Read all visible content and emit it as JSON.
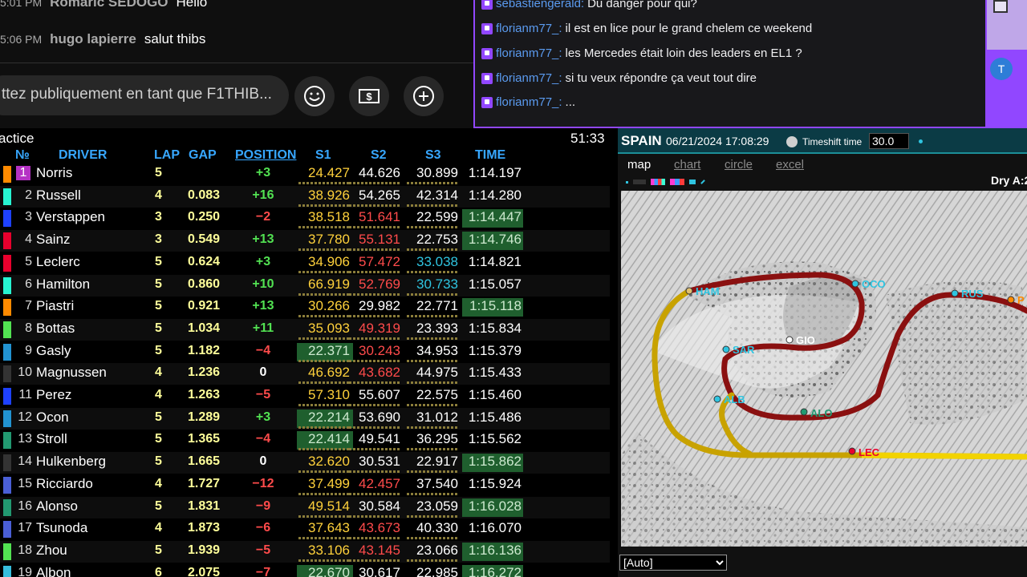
{
  "youtube_chat": {
    "messages": [
      {
        "time": "5:01 PM",
        "author": "Romaric SEDOGO",
        "text": "Hello"
      },
      {
        "time": "5:06 PM",
        "author": "hugo lapierre",
        "text": "salut thibs"
      }
    ],
    "input_placeholder": "ttez publiquement en tant que F1THIB..."
  },
  "twitch_chat": {
    "messages": [
      {
        "author": "sebastiengerald:",
        "text": "Du danger pour qui?"
      },
      {
        "author": "florianm77_:",
        "text": "il est en lice pour le grand chelem ce weekend"
      },
      {
        "author": "florianm77_:",
        "text": "les Mercedes était loin des leaders en EL1 ?"
      },
      {
        "author": "florianm77_:",
        "text": "si tu veux répondre ça veut tout dire"
      },
      {
        "author": "florianm77_:",
        "text": "..."
      }
    ],
    "avatar_letter": "T"
  },
  "timing": {
    "session_label": "actice",
    "clock": "51:33",
    "headers": {
      "no": "№",
      "driver": "DRIVER",
      "lap": "LAP",
      "gap": "GAP",
      "position": "POSITION",
      "s1": "S1",
      "s2": "S2",
      "s3": "S3",
      "time": "TIME"
    },
    "rows": [
      {
        "pos": "1",
        "driver": "Norris",
        "lap": "5",
        "gap": "",
        "change": "+3",
        "s1": "24.427",
        "s2": "44.626",
        "s3": "30.899",
        "time": "1:14.197",
        "team_color": "#ff8a00"
      },
      {
        "pos": "2",
        "driver": "Russell",
        "lap": "4",
        "gap": "0.083",
        "change": "+16",
        "s1": "38.926",
        "s2": "54.265",
        "s3": "42.314",
        "time": "1:14.280",
        "team_color": "#27f4d2"
      },
      {
        "pos": "3",
        "driver": "Verstappen",
        "lap": "3",
        "gap": "0.250",
        "change": "−2",
        "s1": "38.518",
        "s2": "51.641",
        "s3": "22.599",
        "time": "1:14.447",
        "team_color": "#1e41ff"
      },
      {
        "pos": "4",
        "driver": "Sainz",
        "lap": "3",
        "gap": "0.549",
        "change": "+13",
        "s1": "37.780",
        "s2": "55.131",
        "s3": "22.753",
        "time": "1:14.746",
        "team_color": "#e8002d"
      },
      {
        "pos": "5",
        "driver": "Leclerc",
        "lap": "5",
        "gap": "0.624",
        "change": "+3",
        "s1": "34.906",
        "s2": "57.472",
        "s3": "33.038",
        "time": "1:14.821",
        "team_color": "#e8002d"
      },
      {
        "pos": "6",
        "driver": "Hamilton",
        "lap": "5",
        "gap": "0.860",
        "change": "+10",
        "s1": "66.919",
        "s2": "52.769",
        "s3": "30.733",
        "time": "1:15.057",
        "team_color": "#27f4d2"
      },
      {
        "pos": "7",
        "driver": "Piastri",
        "lap": "5",
        "gap": "0.921",
        "change": "+13",
        "s1": "30.266",
        "s2": "29.982",
        "s3": "22.771",
        "time": "1:15.118",
        "team_color": "#ff8a00"
      },
      {
        "pos": "8",
        "driver": "Bottas",
        "lap": "5",
        "gap": "1.034",
        "change": "+11",
        "s1": "35.093",
        "s2": "49.319",
        "s3": "23.393",
        "time": "1:15.834",
        "team_color": "#52e252"
      },
      {
        "pos": "9",
        "driver": "Gasly",
        "lap": "5",
        "gap": "1.182",
        "change": "−4",
        "s1": "22.371",
        "s2": "30.243",
        "s3": "34.953",
        "time": "1:15.379",
        "team_color": "#2293d1"
      },
      {
        "pos": "10",
        "driver": "Magnussen",
        "lap": "4",
        "gap": "1.236",
        "change": "0",
        "s1": "46.692",
        "s2": "43.682",
        "s3": "44.975",
        "time": "1:15.433",
        "team_color": "#333333"
      },
      {
        "pos": "11",
        "driver": "Perez",
        "lap": "4",
        "gap": "1.263",
        "change": "−5",
        "s1": "57.310",
        "s2": "55.607",
        "s3": "22.575",
        "time": "1:15.460",
        "team_color": "#1e41ff"
      },
      {
        "pos": "12",
        "driver": "Ocon",
        "lap": "5",
        "gap": "1.289",
        "change": "+3",
        "s1": "22.214",
        "s2": "53.690",
        "s3": "31.012",
        "time": "1:15.486",
        "team_color": "#2293d1"
      },
      {
        "pos": "13",
        "driver": "Stroll",
        "lap": "5",
        "gap": "1.365",
        "change": "−4",
        "s1": "22.414",
        "s2": "49.541",
        "s3": "36.295",
        "time": "1:15.562",
        "team_color": "#229971"
      },
      {
        "pos": "14",
        "driver": "Hulkenberg",
        "lap": "5",
        "gap": "1.665",
        "change": "0",
        "s1": "32.620",
        "s2": "30.531",
        "s3": "22.917",
        "time": "1:15.862",
        "team_color": "#333333"
      },
      {
        "pos": "15",
        "driver": "Ricciardo",
        "lap": "4",
        "gap": "1.727",
        "change": "−12",
        "s1": "37.499",
        "s2": "42.457",
        "s3": "37.540",
        "time": "1:15.924",
        "team_color": "#4a5fd6"
      },
      {
        "pos": "16",
        "driver": "Alonso",
        "lap": "5",
        "gap": "1.831",
        "change": "−9",
        "s1": "49.514",
        "s2": "30.584",
        "s3": "23.059",
        "time": "1:16.028",
        "team_color": "#229971"
      },
      {
        "pos": "17",
        "driver": "Tsunoda",
        "lap": "4",
        "gap": "1.873",
        "change": "−6",
        "s1": "37.643",
        "s2": "43.673",
        "s3": "40.330",
        "time": "1:16.070",
        "team_color": "#4a5fd6"
      },
      {
        "pos": "18",
        "driver": "Zhou",
        "lap": "5",
        "gap": "1.939",
        "change": "−5",
        "s1": "33.106",
        "s2": "43.145",
        "s3": "23.066",
        "time": "1:16.136",
        "team_color": "#52e252"
      },
      {
        "pos": "19",
        "driver": "Albon",
        "lap": "6",
        "gap": "2.075",
        "change": "−7",
        "s1": "22.670",
        "s2": "30.617",
        "s3": "22.985",
        "time": "1:16.272",
        "team_color": "#37bedd"
      }
    ]
  },
  "track": {
    "country": "SPAIN",
    "datetime": "06/21/2024 17:08:29",
    "timeshift_label": "Timeshift time",
    "timeshift_value": "30.0",
    "tabs": [
      "map",
      "chart",
      "circle",
      "excel"
    ],
    "conditions": "Dry A:2",
    "driver_markers": [
      "HAM",
      "OCO",
      "RUS",
      "P",
      "SAR",
      "GIO",
      "ALB",
      "ALO",
      "LEC"
    ],
    "view_select": "[Auto]"
  }
}
